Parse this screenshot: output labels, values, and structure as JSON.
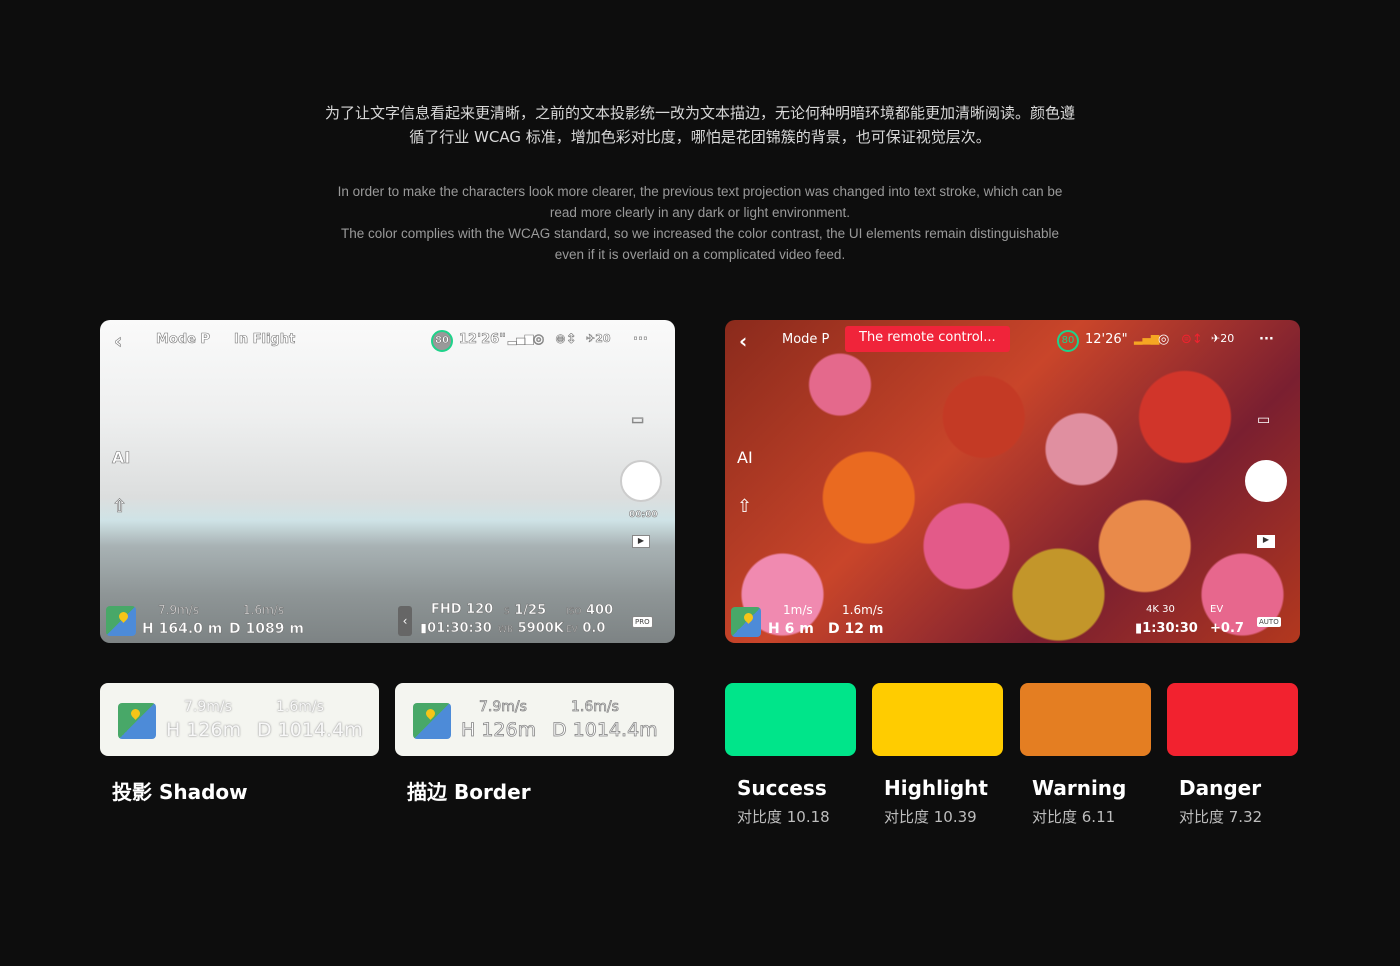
{
  "intro": {
    "cn": [
      "为了让文字信息看起来更清晰，之前的文本投影统一改为文本描边，无论何种明暗环境都能更加清晰阅读。颜色遵",
      "循了行业 WCAG 标准，增加色彩对比度，哪怕是花团锦簇的背景，也可保证视觉层次。"
    ],
    "en": [
      "In order to make the characters look more clearer, the previous text projection was changed into text stroke, which can be",
      "read more clearly in any dark or light environment.",
      "The color complies with the WCAG standard, so we increased the color contrast, the UI elements remain distinguishable",
      "even if it is overlaid on a complicated video feed."
    ]
  },
  "screen1": {
    "mode": "Mode P",
    "status": "In Flight",
    "battery": "80",
    "time": "12'26\"",
    "sats": "20",
    "record_time": "00:00",
    "hspeed": "7.9m/s",
    "vspeed": "1.6m/s",
    "height": "H 164.0 m",
    "distance": "D 1089 m",
    "res": "FHD 120",
    "storage": "01:30:30",
    "s_label": "S",
    "shutter": "1/25",
    "wb_label": "WB",
    "wb": "5900K",
    "iso_label": "ISO",
    "iso": "400",
    "ev_label": "EV",
    "ev": "0.0",
    "mode_badge": "PRO"
  },
  "screen2": {
    "mode": "Mode P",
    "alert": "The remote control...",
    "battery": "80",
    "time": "12'26\"",
    "sats": "20",
    "hspeed": "1m/s",
    "vspeed": "1.6m/s",
    "height": "H 6 m",
    "distance": "D 12 m",
    "res": "4K 30",
    "storage": "1:30:30",
    "ev_label": "EV",
    "ev": "+0.7",
    "mode_badge": "AUTO"
  },
  "tiles": [
    {
      "hspeed": "7.9m/s",
      "vspeed": "1.6m/s",
      "height": "H 126m",
      "distance": "D 1014.4m",
      "label": "投影 Shadow"
    },
    {
      "hspeed": "7.9m/s",
      "vspeed": "1.6m/s",
      "height": "H 126m",
      "distance": "D 1014.4m",
      "label": "描边 Border"
    }
  ],
  "swatches": [
    {
      "name": "Success",
      "contrast": "对比度 10.18",
      "color": "#00e58a"
    },
    {
      "name": "Highlight",
      "contrast": "对比度 10.39",
      "color": "#ffcc00"
    },
    {
      "name": "Warning",
      "contrast": "对比度 6.11",
      "color": "#e47e22"
    },
    {
      "name": "Danger",
      "contrast": "对比度 7.32",
      "color": "#f2222f"
    }
  ]
}
